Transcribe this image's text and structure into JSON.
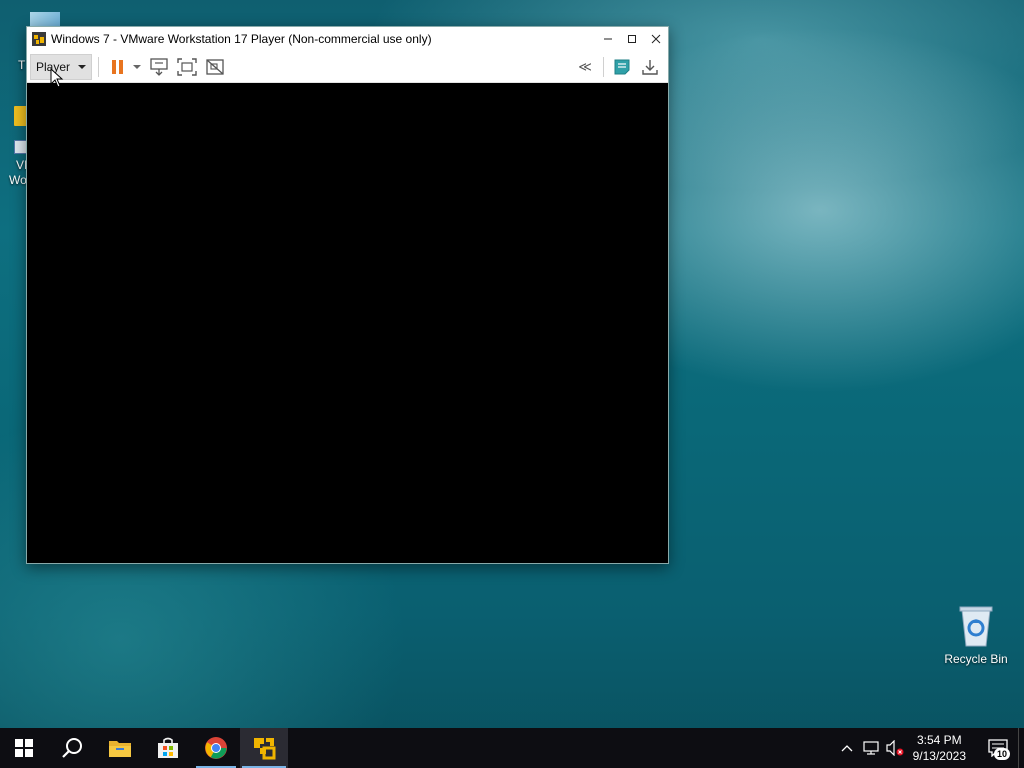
{
  "window": {
    "title": "Windows 7 - VMware Workstation 17 Player (Non-commercial use only)",
    "minimize_label": "–",
    "maximize_label": "□",
    "close_label": "✕"
  },
  "toolbar": {
    "player_menu_label": "Player",
    "buttons": [
      {
        "icon": "pause-icon"
      },
      {
        "icon": "power-dropdown-icon"
      },
      {
        "icon": "send-ctrl-alt-del-icon"
      },
      {
        "icon": "fullscreen-icon"
      },
      {
        "icon": "unity-icon"
      },
      {
        "icon": "collapse-toolbar-icon"
      },
      {
        "icon": "message-log-icon"
      },
      {
        "icon": "software-update-icon"
      }
    ],
    "collapse_label": "≪"
  },
  "desktop": {
    "recycle_bin_label": "Recycle Bin",
    "left_icon_fragments": [
      "T",
      "VI",
      "Wo"
    ]
  },
  "taskbar": {
    "items": [
      "start-icon",
      "search-icon",
      "file-explorer-icon",
      "microsoft-store-icon",
      "chrome-icon",
      "vmware-player-icon"
    ],
    "clock_time": "3:54 PM",
    "clock_date": "9/13/2023",
    "notification_count": "10"
  },
  "colors": {
    "pause_accent": "#e8741f",
    "vmware_accent": "#f0b400",
    "taskbar_bg": "#0d0d12"
  }
}
